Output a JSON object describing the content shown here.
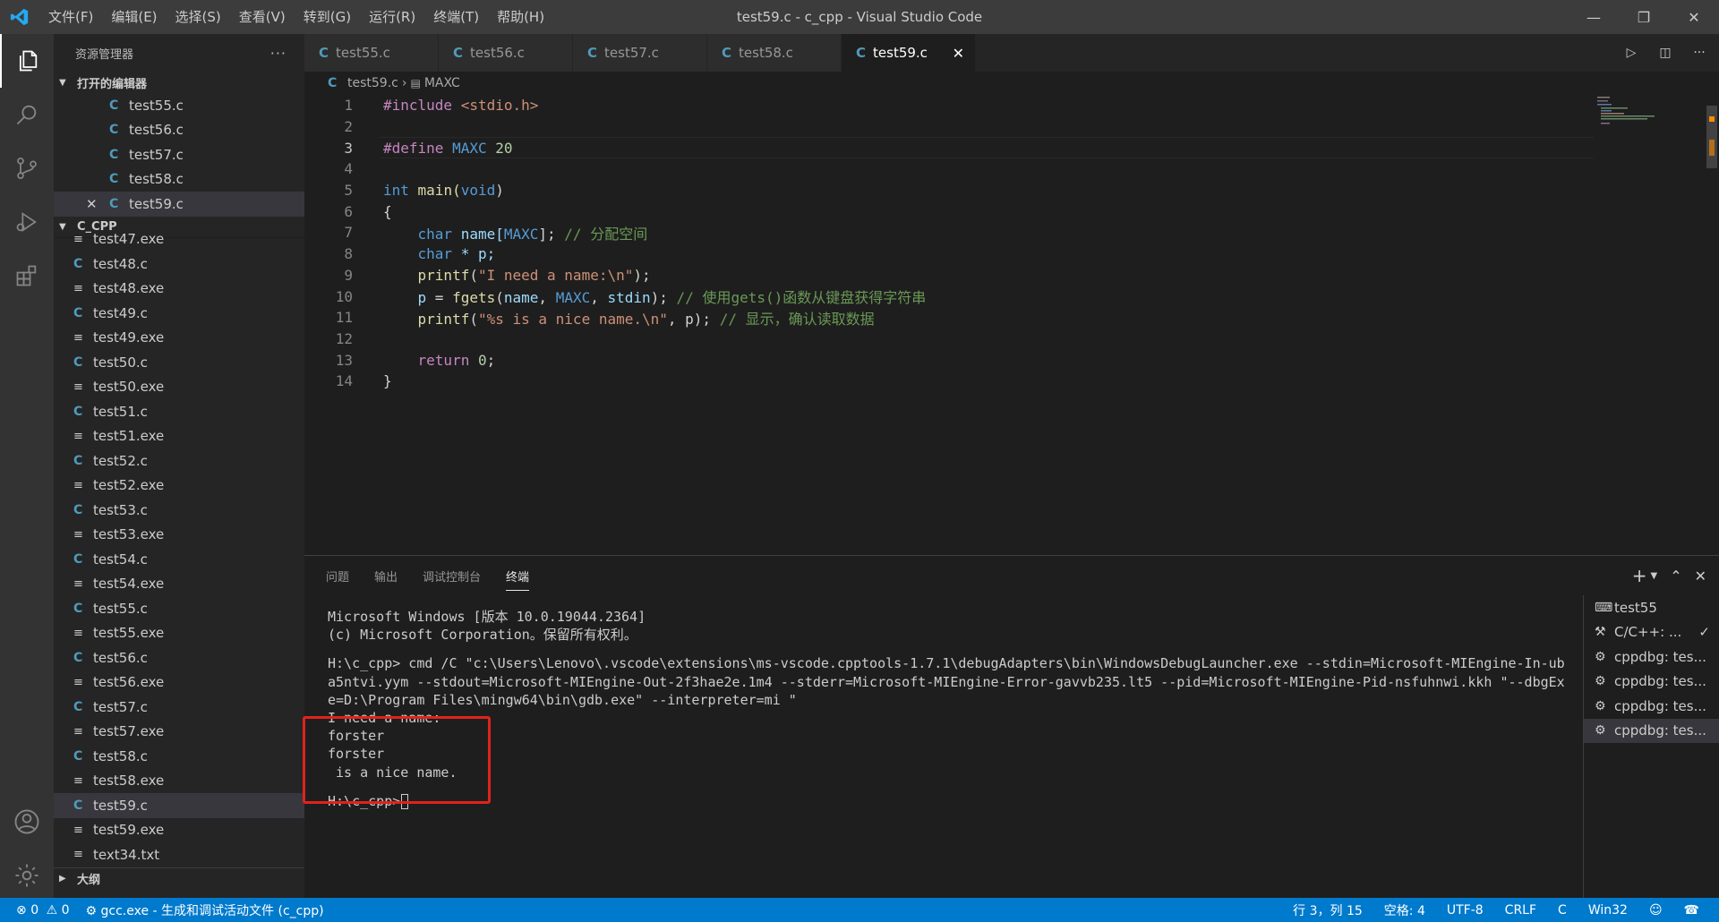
{
  "window": {
    "title": "test59.c - c_cpp - Visual Studio Code",
    "menu": [
      "文件(F)",
      "编辑(E)",
      "选择(S)",
      "查看(V)",
      "转到(G)",
      "运行(R)",
      "终端(T)",
      "帮助(H)"
    ]
  },
  "sidebar": {
    "title": "资源管理器",
    "open_editors_title": "打开的编辑器",
    "open_editors": [
      "test55.c",
      "test56.c",
      "test57.c",
      "test58.c",
      "test59.c"
    ],
    "folder_title": "C_CPP",
    "files": [
      {
        "name": "test47.exe",
        "type": "exe"
      },
      {
        "name": "test48.c",
        "type": "c"
      },
      {
        "name": "test48.exe",
        "type": "exe"
      },
      {
        "name": "test49.c",
        "type": "c"
      },
      {
        "name": "test49.exe",
        "type": "exe"
      },
      {
        "name": "test50.c",
        "type": "c"
      },
      {
        "name": "test50.exe",
        "type": "exe"
      },
      {
        "name": "test51.c",
        "type": "c"
      },
      {
        "name": "test51.exe",
        "type": "exe"
      },
      {
        "name": "test52.c",
        "type": "c"
      },
      {
        "name": "test52.exe",
        "type": "exe"
      },
      {
        "name": "test53.c",
        "type": "c"
      },
      {
        "name": "test53.exe",
        "type": "exe"
      },
      {
        "name": "test54.c",
        "type": "c"
      },
      {
        "name": "test54.exe",
        "type": "exe"
      },
      {
        "name": "test55.c",
        "type": "c"
      },
      {
        "name": "test55.exe",
        "type": "exe"
      },
      {
        "name": "test56.c",
        "type": "c"
      },
      {
        "name": "test56.exe",
        "type": "exe"
      },
      {
        "name": "test57.c",
        "type": "c"
      },
      {
        "name": "test57.exe",
        "type": "exe"
      },
      {
        "name": "test58.c",
        "type": "c"
      },
      {
        "name": "test58.exe",
        "type": "exe"
      },
      {
        "name": "test59.c",
        "type": "c"
      },
      {
        "name": "test59.exe",
        "type": "exe"
      },
      {
        "name": "text34.txt",
        "type": "txt"
      }
    ],
    "outline_title": "大纲"
  },
  "tabs": [
    "test55.c",
    "test56.c",
    "test57.c",
    "test58.c",
    "test59.c"
  ],
  "active_tab": "test59.c",
  "breadcrumb": {
    "file": "test59.c",
    "symbol": "MAXC"
  },
  "code_lines": [
    "1",
    "2",
    "3",
    "4",
    "5",
    "6",
    "7",
    "8",
    "9",
    "10",
    "11",
    "12",
    "13",
    "14"
  ],
  "code": {
    "l1a": "#include",
    "l1b": " <stdio.h>",
    "l3a": "#define",
    "l3b": " MAXC",
    "l3c": " 20",
    "l5a": "int",
    "l5b": " main(",
    "l5c": "void",
    "l5d": ")",
    "l6": "{",
    "l7a": "char",
    "l7b": " name[",
    "l7c": "MAXC",
    "l7d": "];",
    "l7e": " // 分配空间",
    "l8a": "char",
    "l8b": " * p;",
    "l9a": "printf",
    "l9b": "(",
    "l9c": "\"I need a name:\\n\"",
    "l9d": ");",
    "l10a": "p",
    "l10b": " = ",
    "l10c": "fgets",
    "l10d": "(",
    "l10e": "name",
    "l10f": ", ",
    "l10g": "MAXC",
    "l10h": ", ",
    "l10i": "stdin",
    "l10j": ");",
    "l10k": " // 使用gets()函数从键盘获得字符串",
    "l11a": "printf",
    "l11b": "(",
    "l11c": "\"%s is a nice name.\\n\"",
    "l11d": ", p);",
    "l11e": " // 显示，确认读取数据",
    "l13a": "return",
    "l13b": " 0",
    "l13c": ";",
    "l14": "}"
  },
  "panel": {
    "tabs": [
      "问题",
      "输出",
      "调试控制台",
      "终端"
    ],
    "active_tab": "终端",
    "terminal_lines": [
      "Microsoft Windows [版本 10.0.19044.2364]",
      "(c) Microsoft Corporation。保留所有权利。",
      "",
      "H:\\c_cpp> cmd /C \"c:\\Users\\Lenovo\\.vscode\\extensions\\ms-vscode.cpptools-1.7.1\\debugAdapters\\bin\\WindowsDebugLauncher.exe --stdin=Microsoft-MIEngine-In-ub",
      "a5ntvi.yym --stdout=Microsoft-MIEngine-Out-2f3hae2e.1m4 --stderr=Microsoft-MIEngine-Error-gavvb235.lt5 --pid=Microsoft-MIEngine-Pid-nsfuhnwi.kkh \"--dbgEx",
      "e=D:\\Program Files\\mingw64\\bin\\gdb.exe\" --interpreter=mi \"",
      "I need a name:",
      "forster",
      "forster",
      " is a nice name.",
      "",
      "H:\\c_cpp>"
    ],
    "terminal_list": [
      {
        "label": "test55",
        "icon": "terminal-icon"
      },
      {
        "label": "C/C++: ...",
        "icon": "tools-icon",
        "check": "✓"
      },
      {
        "label": "cppdbg: tes...",
        "icon": "debug-icon"
      },
      {
        "label": "cppdbg: tes...",
        "icon": "debug-icon"
      },
      {
        "label": "cppdbg: tes...",
        "icon": "debug-icon"
      },
      {
        "label": "cppdbg: tes...",
        "icon": "debug-icon"
      }
    ]
  },
  "status": {
    "errors": "0",
    "warnings": "0",
    "task": "gcc.exe - 生成和调试活动文件 (c_cpp)",
    "position": "行 3，列 15",
    "spaces": "空格: 4",
    "encoding": "UTF-8",
    "eol": "CRLF",
    "language": "C",
    "platform": "Win32"
  },
  "colors": {
    "accent": "#007acc",
    "highlight_box": "#e0231b",
    "c_icon": "#519aba"
  }
}
